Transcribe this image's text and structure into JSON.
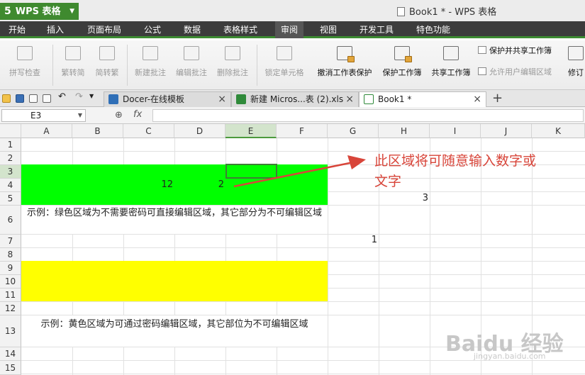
{
  "titlebar": {
    "app_logo": "5",
    "app_name": "WPS 表格",
    "window_title": "Book1 * - WPS 表格"
  },
  "menu": [
    {
      "label": "开始"
    },
    {
      "label": "插入"
    },
    {
      "label": "页面布局"
    },
    {
      "label": "公式"
    },
    {
      "label": "数据"
    },
    {
      "label": "表格样式"
    },
    {
      "label": "审阅",
      "active": true
    },
    {
      "label": "视图"
    },
    {
      "label": "开发工具"
    },
    {
      "label": "特色功能"
    }
  ],
  "ribbon": {
    "spell_check": "拼写检查",
    "to_traditional": "繁转简",
    "to_simplified": "简转繁",
    "new_comment": "新建批注",
    "edit_comment": "编辑批注",
    "delete_comment": "删除批注",
    "lock_cell": "锁定单元格",
    "unprotect_sheet": "撤消工作表保护",
    "protect_workbook": "保护工作簿",
    "share_workbook": "共享工作簿",
    "protect_and_share": "保护并共享工作簿",
    "allow_edit_ranges": "允许用户编辑区域",
    "track_changes": "修订"
  },
  "tabs": [
    {
      "label": "Docer-在线模板",
      "close": "×"
    },
    {
      "label": "新建 Micros...表 (2).xls",
      "close": "×"
    },
    {
      "label": "Book1 *",
      "close": "×",
      "active": true
    }
  ],
  "new_tab": "+",
  "formula_bar": {
    "name_box": "E3",
    "fx_label": "fx",
    "formula": ""
  },
  "grid": {
    "columns": [
      "A",
      "B",
      "C",
      "D",
      "E",
      "F",
      "G",
      "H",
      "I",
      "J",
      "K"
    ],
    "rows": [
      "1",
      "2",
      "3",
      "4",
      "5",
      "6",
      "7",
      "8",
      "9",
      "10",
      "11",
      "12",
      "13",
      "14",
      "15"
    ],
    "selected_cell": "E3",
    "values": {
      "C4": "12",
      "D4": "2",
      "H5": "3",
      "G7": "1"
    },
    "note_green": "示例：绿色区域为不需要密码可直接编辑区域，其它部分为不可编辑区域",
    "note_yellow": "示例：黄色区域为可通过密码编辑区域，其它部位为不可编辑区域",
    "green_color": "#00ff00",
    "yellow_color": "#ffff00"
  },
  "annotation": {
    "text_line1": "此区域将可随意输入数字或",
    "text_line2": "文字",
    "color": "#d8453a"
  },
  "watermark": {
    "text": "Baidu 经验",
    "sub": "jingyan.baidu.com"
  }
}
